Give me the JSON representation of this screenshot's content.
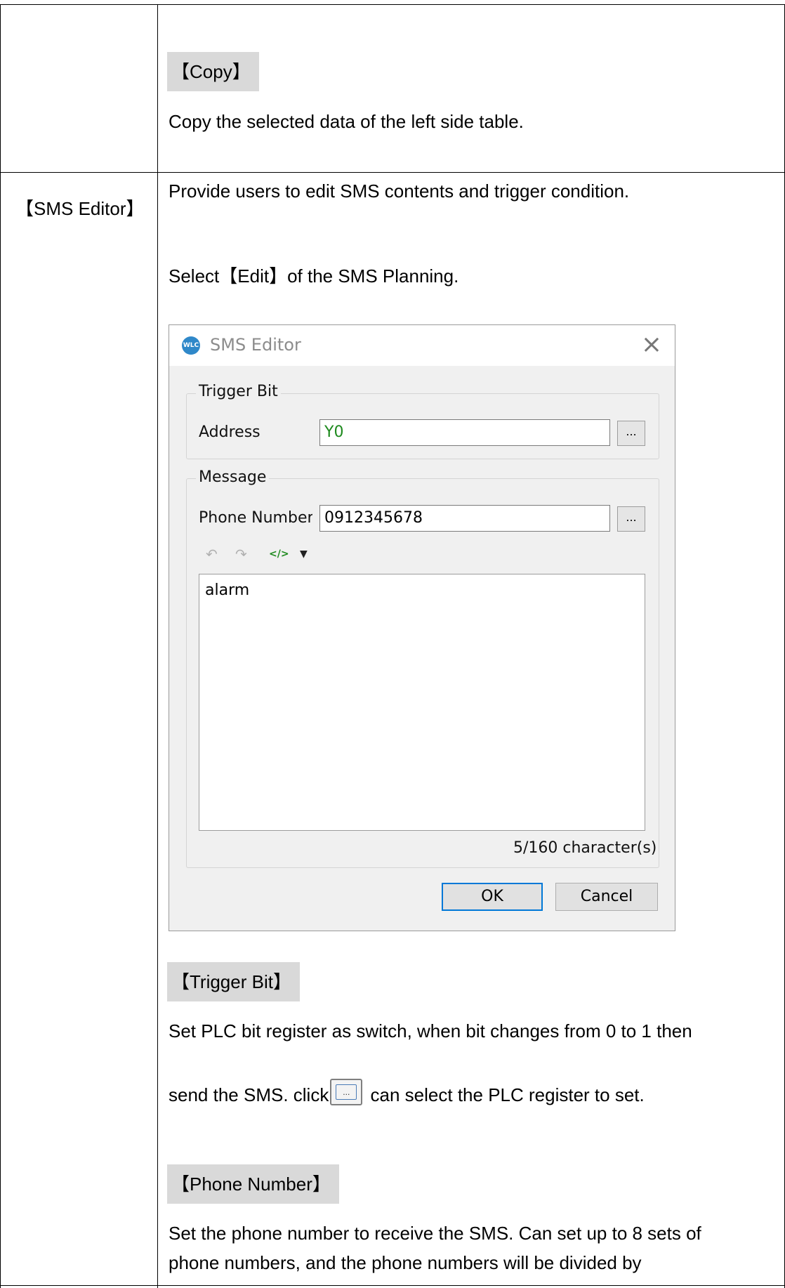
{
  "row1": {
    "tag": "【Copy】",
    "text": "Copy the selected data of the left side table."
  },
  "row2": {
    "label": "【SMS Editor】",
    "intro": "Provide users to edit SMS contents and trigger condition.",
    "select_line": "Select【Edit】of the SMS Planning.",
    "dialog": {
      "logo_text": "WLC",
      "title": "SMS Editor",
      "close_glyph": "×",
      "trigger_group": "Trigger Bit",
      "address_label": "Address",
      "address_value": "Y0",
      "address_value_color": "#1e8a1e",
      "browse_label": "...",
      "message_group": "Message",
      "phone_label": "Phone Number",
      "phone_value": "0912345678",
      "undo_icon": "undo-icon",
      "redo_icon": "redo-icon",
      "tag_icon_text": "</>",
      "message_text": "alarm",
      "counter": "5/160 character(s)",
      "ok_label": "OK",
      "cancel_label": "Cancel"
    },
    "trigger_tag": "【Trigger Bit】",
    "trigger_text_1": "Set PLC bit register as switch, when bit changes from 0 to 1 then",
    "trigger_text_2a": "send the SMS. click",
    "trigger_text_2b": " can select the PLC register to set.",
    "phone_tag": "【Phone Number】",
    "phone_text_1": "Set the phone number to receive the SMS. Can set up to 8 sets of",
    "phone_text_2": "phone numbers, and the phone numbers will be divided by"
  }
}
